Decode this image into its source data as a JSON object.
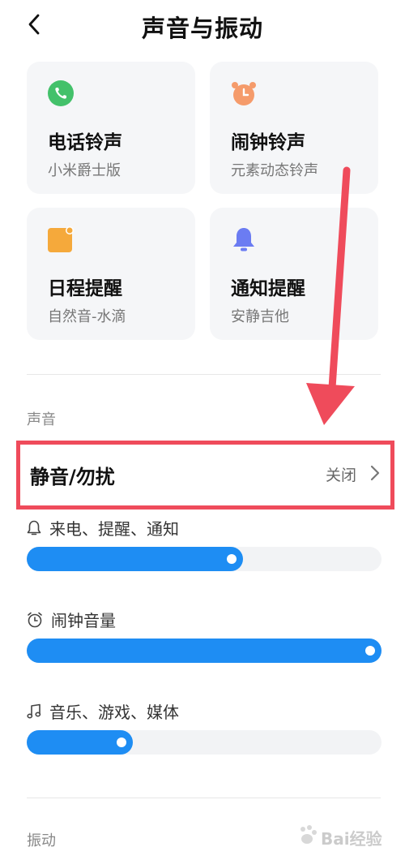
{
  "header": {
    "title": "声音与振动",
    "back_icon": "chevron-left-icon"
  },
  "ringtone_cards": [
    {
      "name": "电话铃声",
      "value": "小米爵士版",
      "icon": "phone-icon",
      "color": "#43c16a"
    },
    {
      "name": "闹钟铃声",
      "value": "元素动态铃声",
      "icon": "alarm-clock-icon",
      "color": "#f59b6b"
    },
    {
      "name": "日程提醒",
      "value": "自然音-水滴",
      "icon": "calendar-icon",
      "color": "#f5a93b"
    },
    {
      "name": "通知提醒",
      "value": "安静吉他",
      "icon": "bell-icon",
      "color": "#6b7cf2"
    }
  ],
  "sound_section": {
    "label": "声音",
    "dnd": {
      "label": "静音/勿扰",
      "value": "关闭"
    },
    "volumes": [
      {
        "label": "来电、提醒、通知",
        "icon": "bell-outline-icon",
        "level": 0.61
      },
      {
        "label": "闹钟音量",
        "icon": "alarm-outline-icon",
        "level": 1.0
      },
      {
        "label": "音乐、游戏、媒体",
        "icon": "music-note-icon",
        "level": 0.3
      }
    ]
  },
  "vibration_section": {
    "label": "振动"
  },
  "colors": {
    "accent": "#1e8df3",
    "highlight": "#ef4b5b",
    "card_bg": "#f5f6f8"
  },
  "watermark": {
    "text": "Bai经验"
  }
}
